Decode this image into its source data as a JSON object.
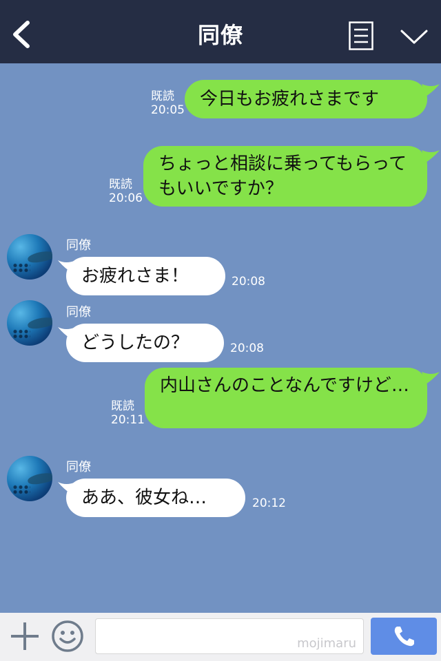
{
  "header": {
    "title": "同僚"
  },
  "messages": [
    {
      "side": "out",
      "text": "今日もお疲れさまです",
      "read": "既読",
      "time": "20:05"
    },
    {
      "side": "out",
      "text": "ちょっと相談に乗ってもらってもいいですか？",
      "read": "既読",
      "time": "20:06"
    },
    {
      "side": "in",
      "sender": "同僚",
      "text": "お疲れさま！",
      "time": "20:08"
    },
    {
      "side": "in",
      "sender": "同僚",
      "text": "どうしたの？",
      "time": "20:08"
    },
    {
      "side": "out",
      "text": "内山さんのことなんですけど…",
      "read": "既読",
      "time": "20:11"
    },
    {
      "side": "in",
      "sender": "同僚",
      "text": "ああ、彼女ね…",
      "time": "20:12"
    }
  ],
  "footer": {
    "input_value": "",
    "watermark": "mojimaru"
  },
  "colors": {
    "header_bg": "#252d44",
    "chat_bg": "#7292c2",
    "outgoing_bubble": "#85e249",
    "incoming_bubble": "#ffffff",
    "call_button": "#5f8de6"
  },
  "icons": [
    "back-icon",
    "menu-icon",
    "chevron-down-icon",
    "plus-icon",
    "emoji-icon",
    "phone-icon"
  ]
}
